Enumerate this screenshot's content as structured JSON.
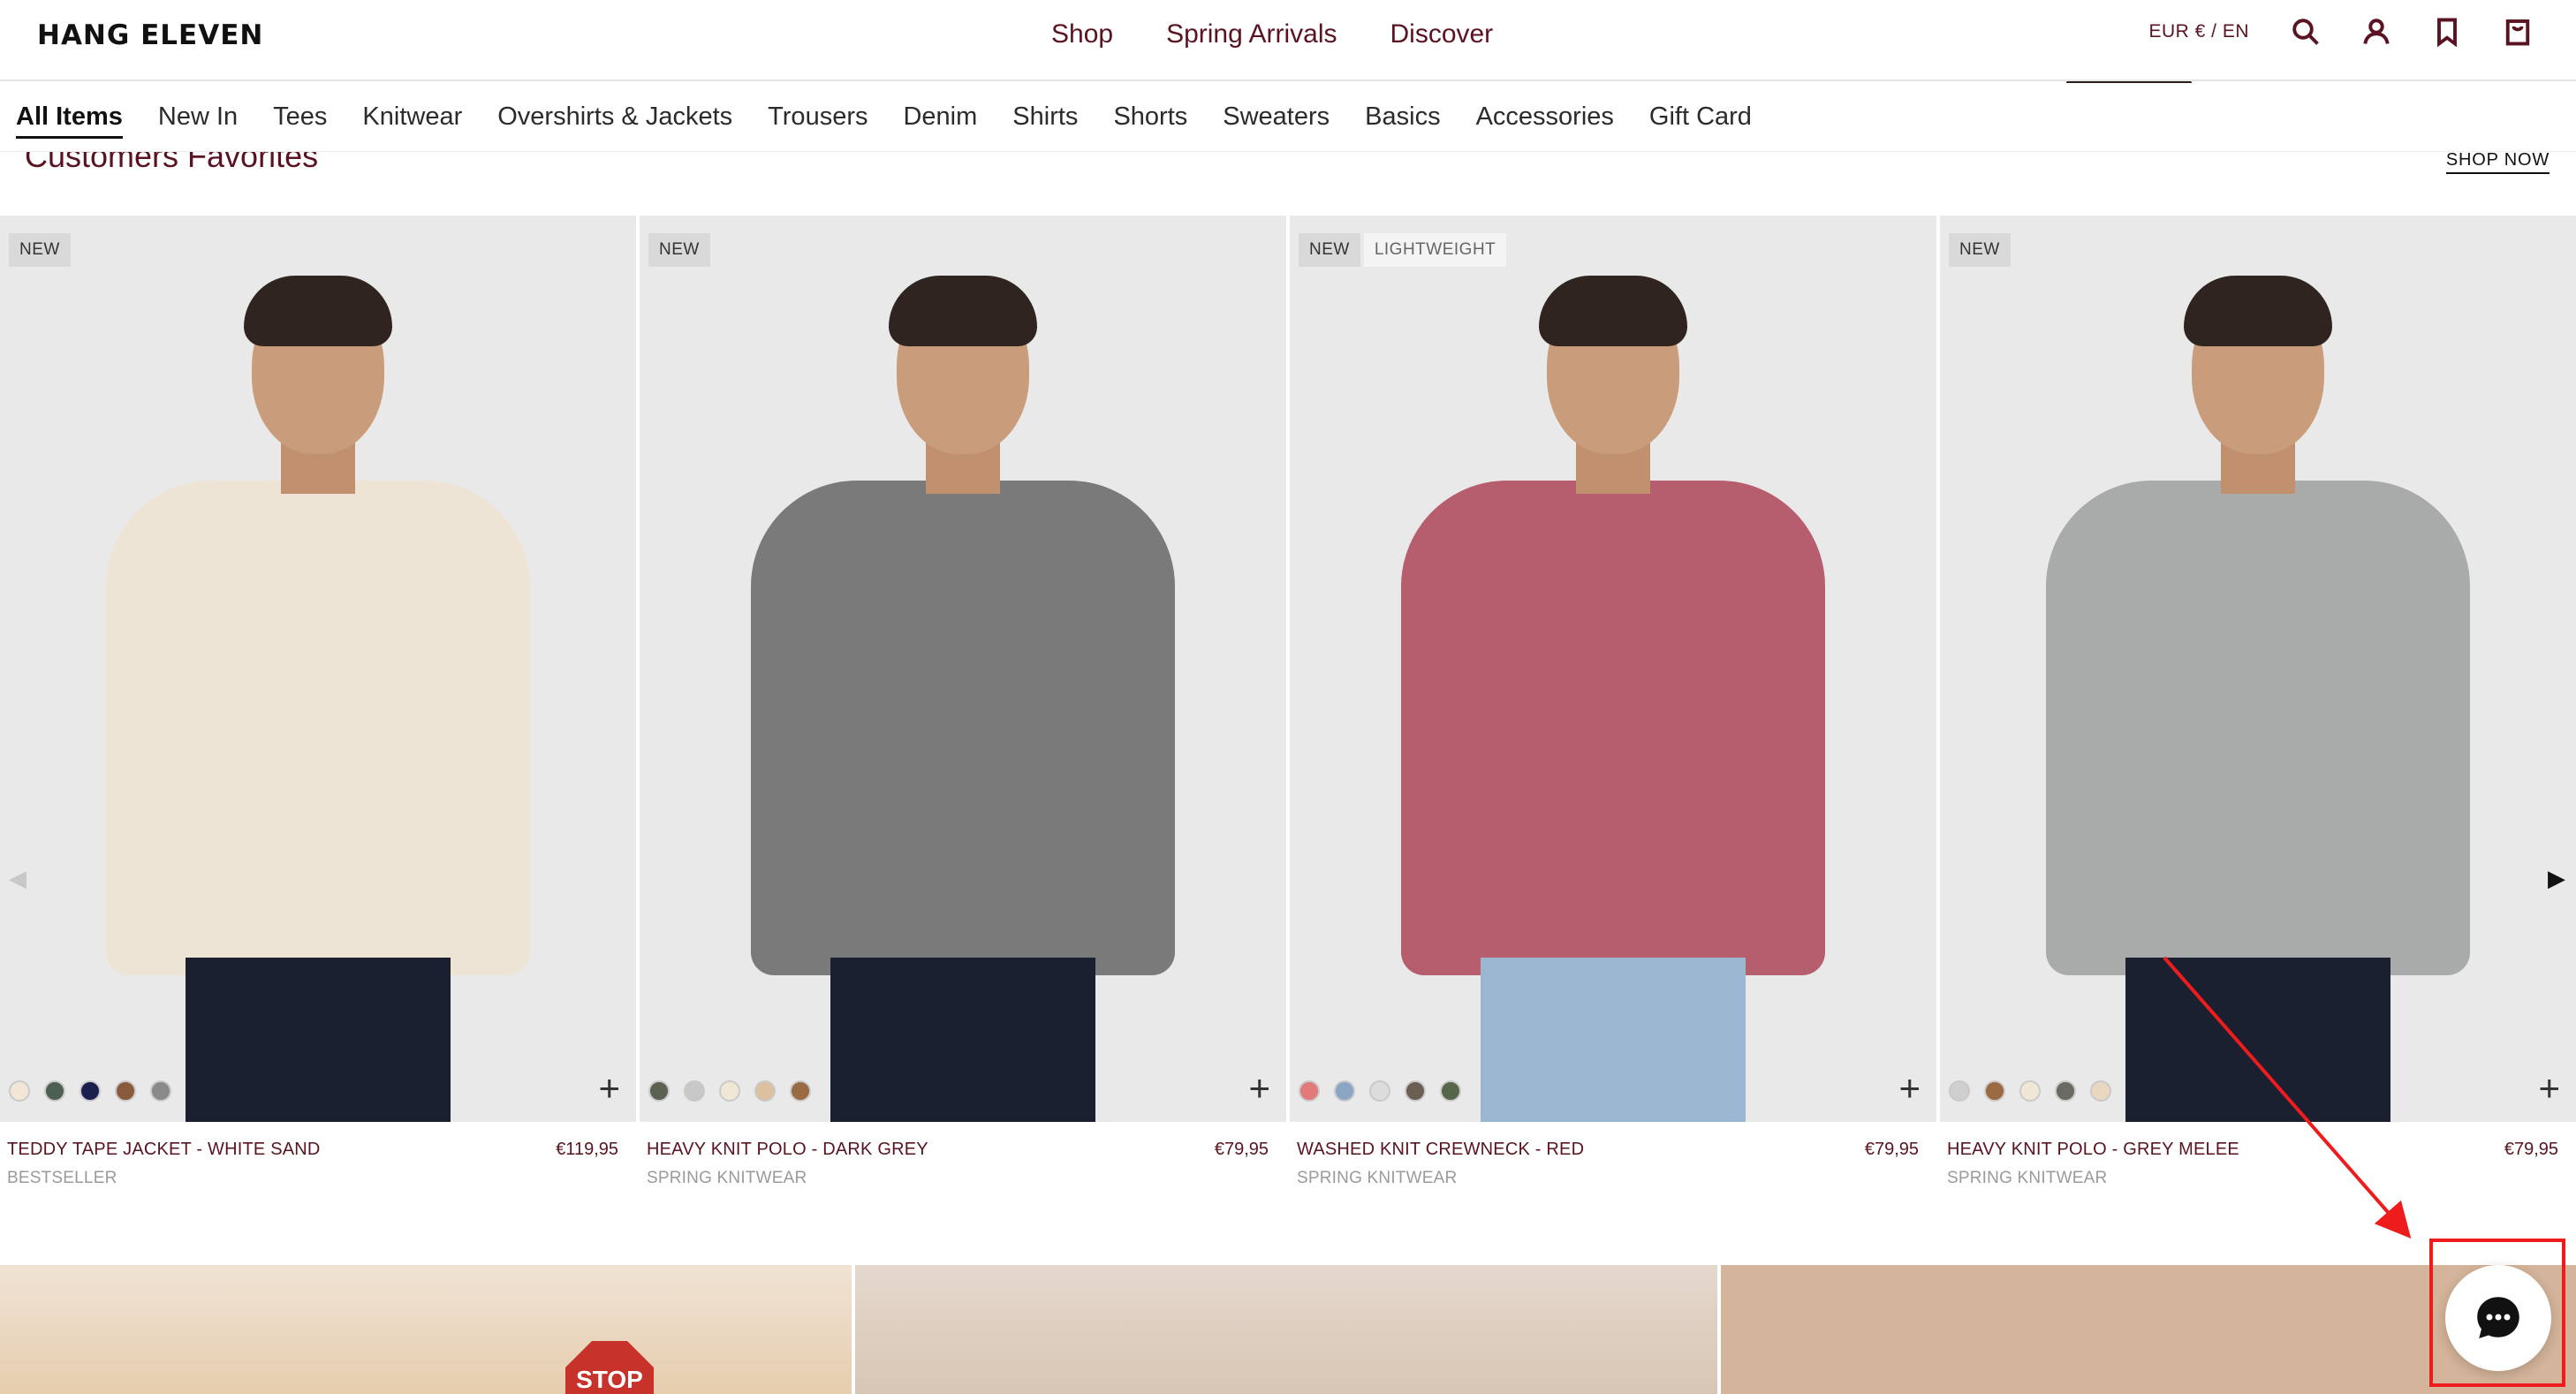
{
  "brand": "HANG ELEVEN",
  "top_nav": [
    "Shop",
    "Spring Arrivals",
    "Discover"
  ],
  "locale": "EUR  € / EN",
  "utility_icons": [
    "search-icon",
    "account-icon",
    "wishlist-icon",
    "cart-icon"
  ],
  "categories": [
    "All Items",
    "New In",
    "Tees",
    "Knitwear",
    "Overshirts & Jackets",
    "Trousers",
    "Denim",
    "Shirts",
    "Shorts",
    "Sweaters",
    "Basics",
    "Accessories",
    "Gift Card"
  ],
  "active_category": "All Items",
  "section": {
    "title": "Customers Favorites",
    "cta": "SHOP NOW"
  },
  "carousel": {
    "prev_icon": "◀",
    "next_icon": "▶"
  },
  "products": [
    {
      "badges": [
        "NEW"
      ],
      "name": "TEDDY TAPE JACKET - WHITE SAND",
      "price": "€119,95",
      "collection": "BESTSELLER",
      "swatches": [
        "#f2e6d6",
        "#4d5e52",
        "#1a1f4e",
        "#8a5a3c",
        "#8a8a8a"
      ],
      "garment_color": "#ede4d6",
      "legs_color": "#1b2030"
    },
    {
      "badges": [
        "NEW"
      ],
      "name": "HEAVY KNIT POLO - DARK GREY",
      "price": "€79,95",
      "collection": "SPRING KNITWEAR",
      "swatches": [
        "#5b6252",
        "#c8c8c8",
        "#f1e7d6",
        "#dcc0a0",
        "#9a6a42"
      ],
      "garment_color": "#7a7a7a",
      "legs_color": "#1b2030"
    },
    {
      "badges": [
        "NEW",
        "LIGHTWEIGHT"
      ],
      "name": "WASHED KNIT CREWNECK - RED",
      "price": "€79,95",
      "collection": "SPRING KNITWEAR",
      "swatches": [
        "#e27a7a",
        "#8aa6c4",
        "#dcdcdc",
        "#6b5e52",
        "#55664a"
      ],
      "garment_color": "#b65e6e",
      "legs_color": "#9bb6d0"
    },
    {
      "badges": [
        "NEW"
      ],
      "name": "HEAVY KNIT POLO - GREY MELEE",
      "price": "€79,95",
      "collection": "SPRING KNITWEAR",
      "swatches": [
        "#cfcfcf",
        "#9a6a42",
        "#f1e7d6",
        "#6a6a62",
        "#ead7c0"
      ],
      "garment_color": "#a9abaa",
      "legs_color": "#1b2030"
    }
  ],
  "add_icon": "+",
  "lifestyle": {
    "stop_sign": "STOP"
  },
  "chat": {
    "icon": "chat-bubble-icon"
  },
  "annotation": {
    "color": "#ee1c1c"
  }
}
